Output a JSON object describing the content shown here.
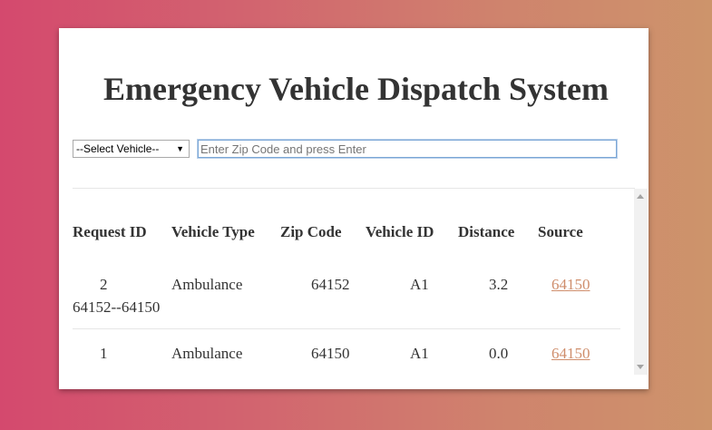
{
  "page": {
    "title": "Emergency Vehicle Dispatch System"
  },
  "controls": {
    "vehicle_select": {
      "selected": "--Select Vehicle--"
    },
    "zip_input": {
      "value": "",
      "placeholder": "Enter Zip Code and press Enter"
    }
  },
  "table": {
    "headers": [
      "Request ID",
      "Vehicle Type",
      "Zip Code",
      "Vehicle ID",
      "Distance",
      "Source"
    ],
    "rows": [
      {
        "request_id": "2",
        "route": "64152--64150",
        "vehicle_type": "Ambulance",
        "zip_code": "64152",
        "vehicle_id": "A1",
        "distance": "3.2",
        "source": "64150"
      },
      {
        "request_id": "1",
        "route": "",
        "vehicle_type": "Ambulance",
        "zip_code": "64150",
        "vehicle_id": "A1",
        "distance": "0.0",
        "source": "64150"
      }
    ]
  },
  "colors": {
    "link": "#cf8e6c",
    "text": "#333333",
    "background_start": "#d4496e",
    "background_end": "#cd946b"
  }
}
